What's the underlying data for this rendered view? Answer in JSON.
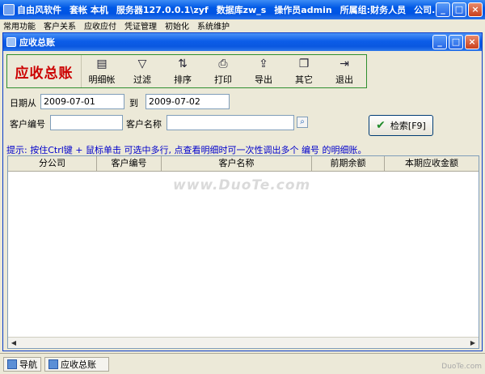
{
  "outer_window": {
    "title_parts": [
      "自由风软件",
      "套帐 本机",
      "服务器127.0.0.1\\zyf",
      "数据库zw_s",
      "操作员admin",
      "所属组:财务人员",
      "公司..."
    ],
    "controls": [
      "_",
      "□",
      "×"
    ]
  },
  "outer_menu": [
    "常用功能",
    "客户关系",
    "应收应付",
    "凭证管理",
    "初始化",
    "系统维护"
  ],
  "inner_window": {
    "title": "应收总账",
    "controls": [
      "_",
      "□",
      "×"
    ]
  },
  "toolbar": {
    "title": "应收总账",
    "buttons": [
      {
        "label": "明细帐",
        "icon": "detail-ledger-icon",
        "glyph": "▤"
      },
      {
        "label": "过滤",
        "icon": "filter-icon",
        "glyph": "▽"
      },
      {
        "label": "排序",
        "icon": "sort-icon",
        "glyph": "⇅"
      },
      {
        "label": "打印",
        "icon": "printer-icon",
        "glyph": "⎙"
      },
      {
        "label": "导出",
        "icon": "export-icon",
        "glyph": "⇪"
      },
      {
        "label": "其它",
        "icon": "other-icon",
        "glyph": "❐"
      },
      {
        "label": "退出",
        "icon": "exit-icon",
        "glyph": "⇥"
      }
    ]
  },
  "filters": {
    "date_from_label": "日期从",
    "date_from": "2009-07-01",
    "date_to_label": "到",
    "date_to": "2009-07-02",
    "customer_code_label": "客户编号",
    "customer_code": "",
    "customer_name_label": "客户名称",
    "customer_name": ""
  },
  "search_button": {
    "label": "检索[F9]"
  },
  "hint": "提示: 按住Ctrl键 + 鼠标单击 可选中多行, 点查看明细时可一次性调出多个 编号 的明细账。",
  "table": {
    "columns": [
      "分公司",
      "客户编号",
      "客户名称",
      "前期余额",
      "本期应收金额"
    ],
    "rows": []
  },
  "watermark": "www.DuoTe.com",
  "taskbar": {
    "items": [
      "导航",
      "应收总账"
    ],
    "corner": "DuoTe.com"
  }
}
